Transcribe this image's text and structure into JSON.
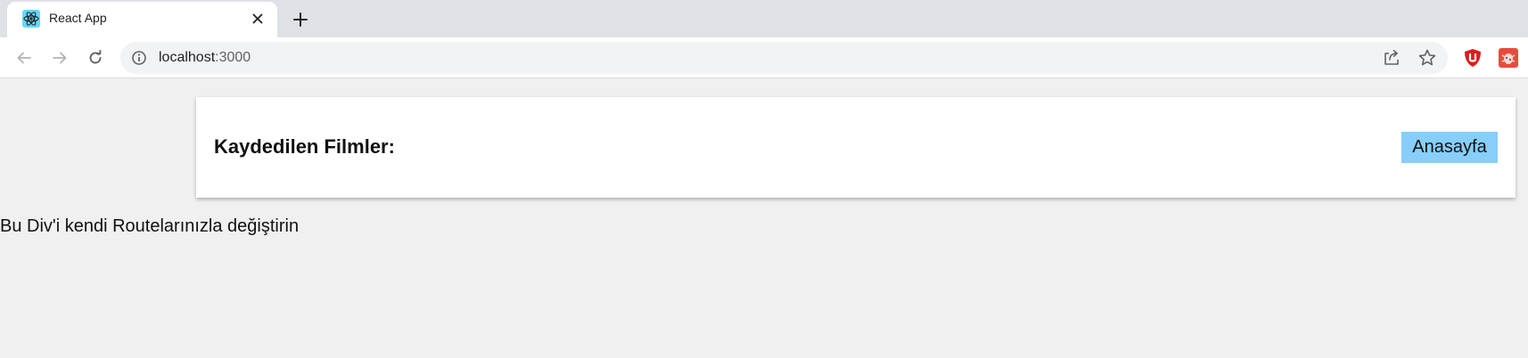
{
  "browser": {
    "tab": {
      "title": "React App",
      "favicon": "react-logo-icon"
    },
    "icons": {
      "close": "close-icon",
      "new_tab": "plus-icon",
      "back": "arrow-left-icon",
      "forward": "arrow-right-icon",
      "reload": "reload-icon",
      "info": "info-icon",
      "share": "share-icon",
      "bookmark": "star-icon",
      "ext1": "ublock-icon",
      "ext2": "bug-extension-icon"
    },
    "address": {
      "host": "localhost",
      "port": ":3000"
    }
  },
  "page": {
    "header": {
      "title": "Kaydedilen Filmler:",
      "home_button": "Anasayfa"
    },
    "placeholder": "Bu Div'i kendi Routelarınızla değiştirin"
  },
  "colors": {
    "page_bg": "#f0f0f0",
    "card_bg": "#ffffff",
    "button_bg": "#87cefa",
    "tabstrip_bg": "#dee1e6"
  }
}
